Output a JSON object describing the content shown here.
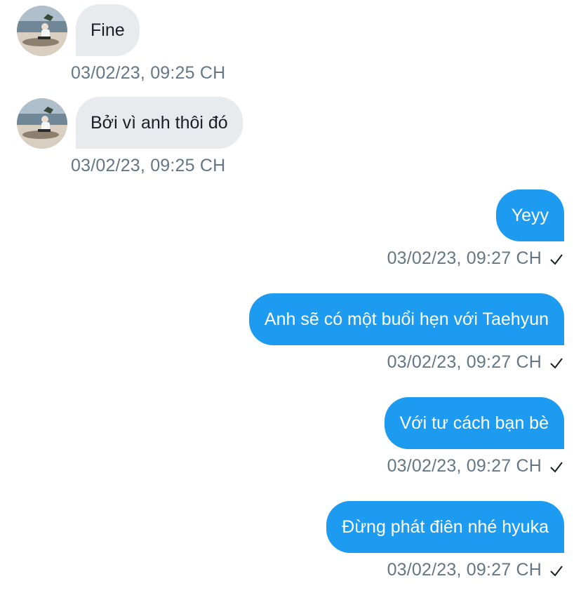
{
  "messages": [
    {
      "direction": "incoming",
      "text": "Fine",
      "timestamp": "03/02/23, 09:25 CH"
    },
    {
      "direction": "incoming",
      "text": "Bởi vì anh thôi đó",
      "timestamp": "03/02/23, 09:25 CH"
    },
    {
      "direction": "outgoing",
      "text": "Yeyy",
      "timestamp": "03/02/23, 09:27 CH"
    },
    {
      "direction": "outgoing",
      "text": "Anh sẽ có một buổi hẹn với Taehyun",
      "timestamp": "03/02/23, 09:27 CH"
    },
    {
      "direction": "outgoing",
      "text": "Với tư cách bạn bè",
      "timestamp": "03/02/23, 09:27 CH"
    },
    {
      "direction": "outgoing",
      "text": "Đừng phát điên nhé hyuka",
      "timestamp": "03/02/23, 09:27 CH"
    }
  ],
  "colors": {
    "incoming_bubble": "#e8ebee",
    "outgoing_bubble": "#1d9bf0",
    "timestamp_text": "#647786"
  },
  "icons": {
    "sent_status": "checkmark-icon",
    "avatar": "user-avatar-photo"
  }
}
